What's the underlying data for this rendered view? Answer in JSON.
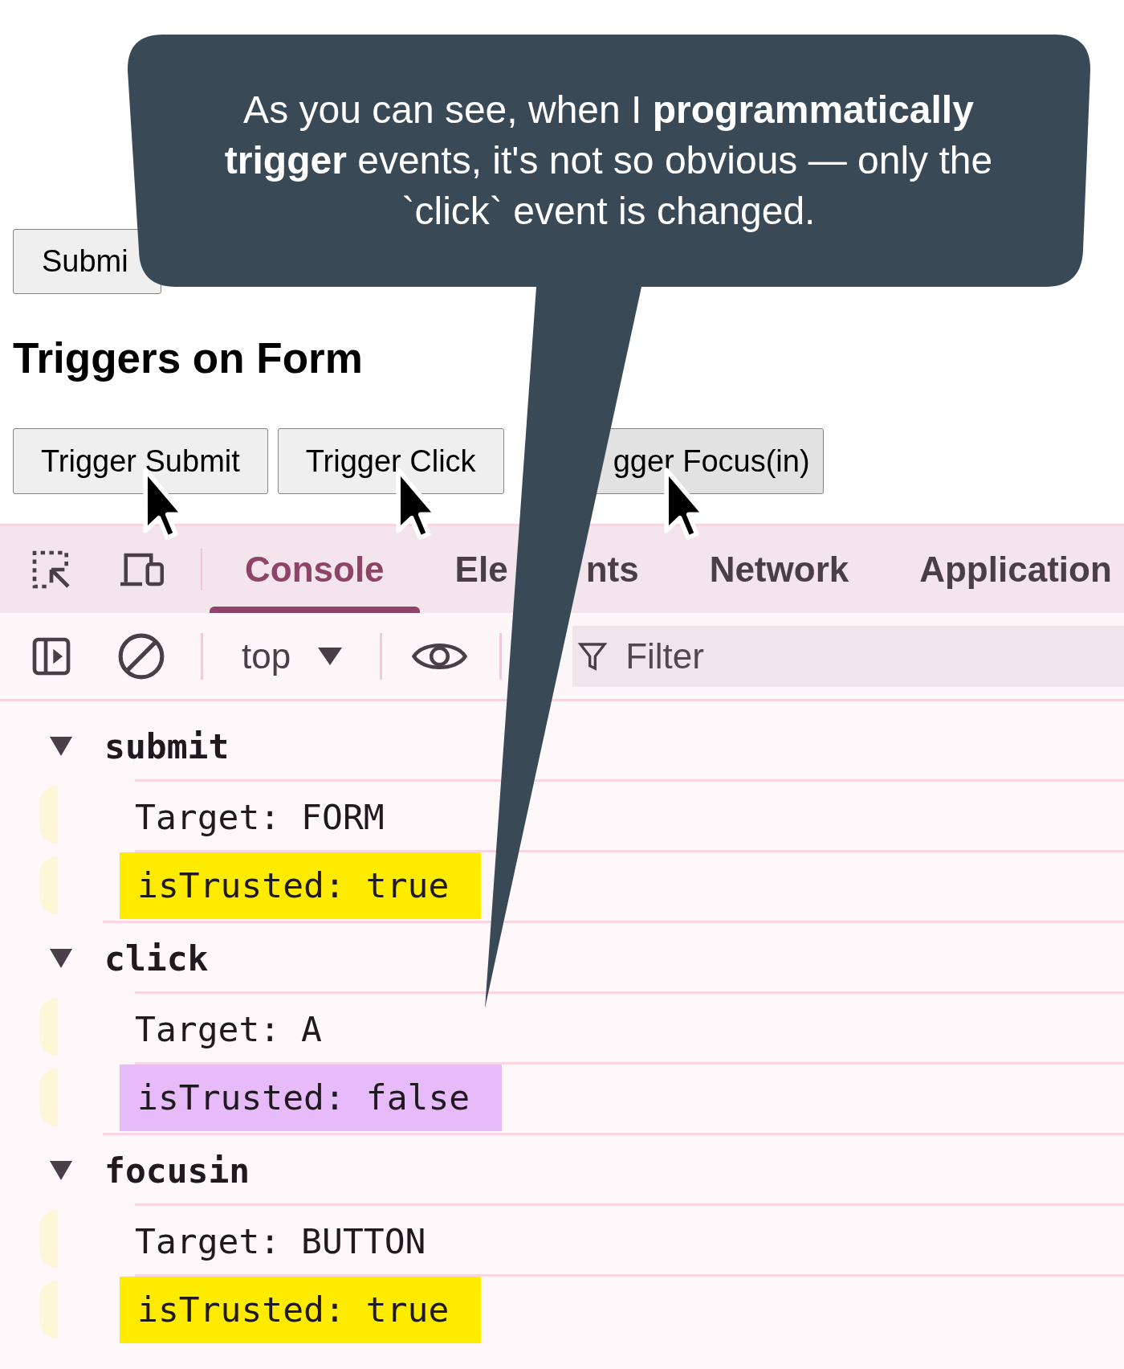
{
  "page": {
    "submit_button": {
      "label": "Submi"
    },
    "heading": "Triggers on Form",
    "trigger_buttons": [
      {
        "label": "Trigger Submit",
        "focused": false,
        "pointer": true
      },
      {
        "label": "Trigger Click",
        "focused": false,
        "pointer": true
      },
      {
        "label": "gger Focus(in)",
        "focused": true,
        "pointer": true
      }
    ]
  },
  "callout": {
    "text": "As you can see, when I **programmatically trigger** events, it's not so obvious — only the `click` event is changed."
  },
  "devtools": {
    "tabs": [
      {
        "label_parts": [
          "Console"
        ],
        "selected": true
      },
      {
        "label_parts": [
          "Ele",
          "nts"
        ],
        "selected": false
      },
      {
        "label_parts": [
          "Network"
        ],
        "selected": false
      },
      {
        "label_parts": [
          "Application"
        ],
        "selected": false
      }
    ],
    "toolbar": {
      "context": "top",
      "filter": {
        "placeholder": "Filter"
      }
    },
    "console_groups": [
      {
        "event": "submit",
        "expanded": true,
        "lines": [
          {
            "text": "Target: FORM"
          },
          {
            "text": "isTrusted: true",
            "color": "#ffeb00"
          }
        ]
      },
      {
        "event": "click",
        "expanded": true,
        "lines": [
          {
            "text": "Target: A"
          },
          {
            "text": "isTrusted: false",
            "color": "#e7bbfa"
          }
        ]
      },
      {
        "event": "focusin",
        "expanded": true,
        "lines": [
          {
            "text": "Target: BUTTON"
          },
          {
            "text": "isTrusted: true",
            "color": "#ffeb00"
          }
        ]
      }
    ]
  }
}
